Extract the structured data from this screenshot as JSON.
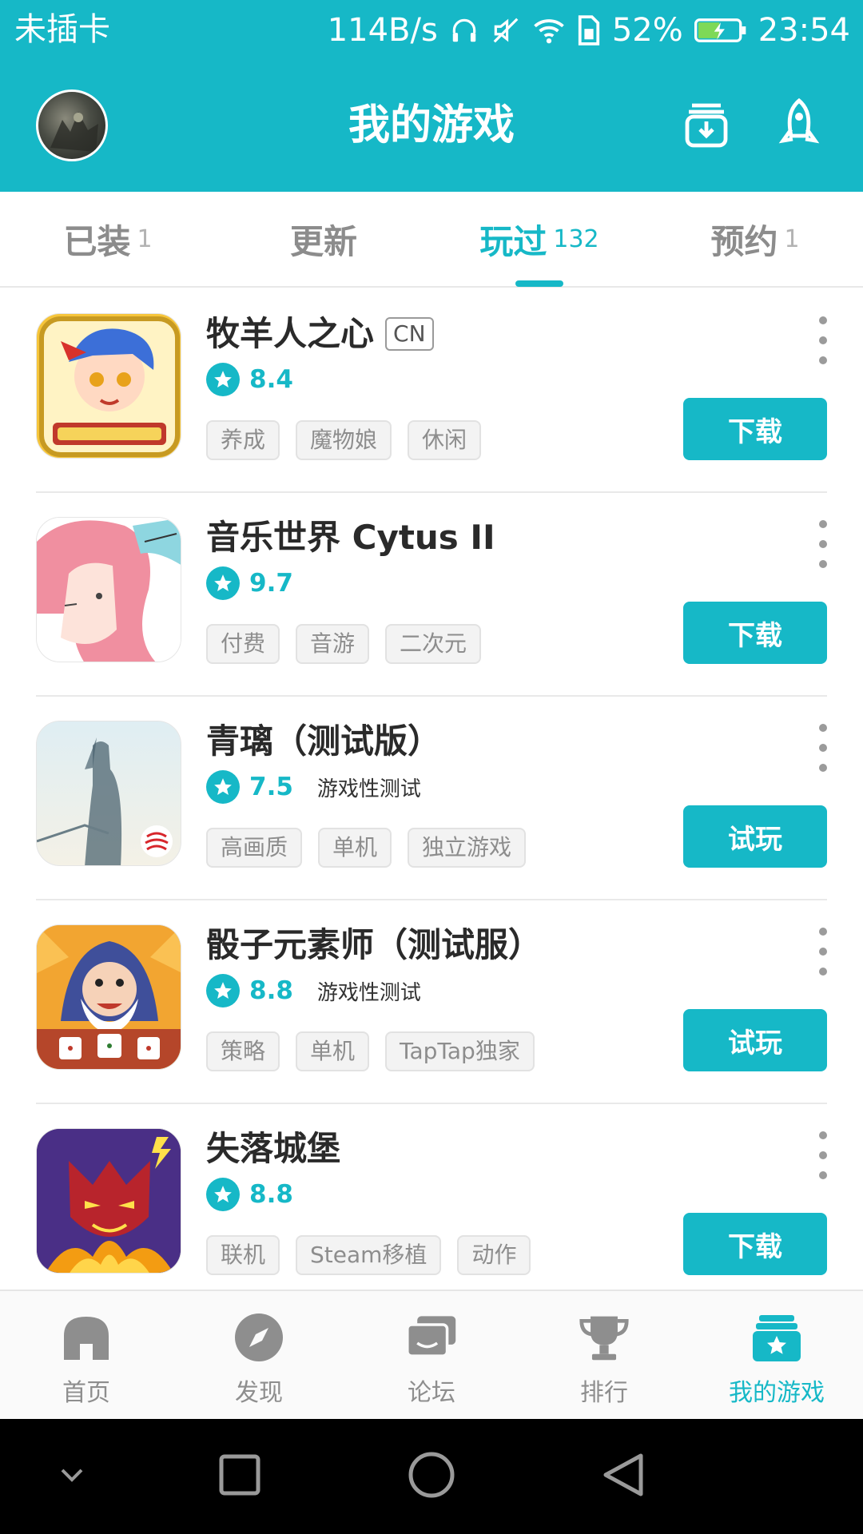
{
  "status_bar": {
    "carrier": "未插卡",
    "net_speed": "114B/s",
    "battery": "52%",
    "time": "23:54"
  },
  "header": {
    "title": "我的游戏",
    "avatar_icon": "user-avatar",
    "download_icon": "download-manager-icon",
    "rocket_icon": "rocket-icon"
  },
  "tabs": [
    {
      "label": "已装",
      "count": "1",
      "active": false
    },
    {
      "label": "更新",
      "count": "",
      "active": false
    },
    {
      "label": "玩过",
      "count": "132",
      "active": true
    },
    {
      "label": "预约",
      "count": "1",
      "active": false
    }
  ],
  "games": [
    {
      "title": "牧羊人之心",
      "badge": "CN",
      "score": "8.4",
      "note": "",
      "tags": [
        "养成",
        "魔物娘",
        "休闲"
      ],
      "action": "下载"
    },
    {
      "title": "音乐世界 Cytus II",
      "badge": "",
      "score": "9.7",
      "note": "",
      "tags": [
        "付费",
        "音游",
        "二次元"
      ],
      "action": "下载"
    },
    {
      "title": "青璃（测试版）",
      "badge": "",
      "score": "7.5",
      "note": "游戏性测试",
      "tags": [
        "高画质",
        "单机",
        "独立游戏"
      ],
      "action": "试玩"
    },
    {
      "title": "骰子元素师（测试服）",
      "badge": "",
      "score": "8.8",
      "note": "游戏性测试",
      "tags": [
        "策略",
        "单机",
        "TapTap独家"
      ],
      "action": "试玩"
    },
    {
      "title": "失落城堡",
      "badge": "",
      "score": "8.8",
      "note": "",
      "tags": [
        "联机",
        "Steam移植",
        "动作"
      ],
      "action": "下载"
    }
  ],
  "bottom_nav": [
    {
      "label": "首页",
      "icon": "home-icon",
      "active": false
    },
    {
      "label": "发现",
      "icon": "compass-icon",
      "active": false
    },
    {
      "label": "论坛",
      "icon": "forum-icon",
      "active": false
    },
    {
      "label": "排行",
      "icon": "trophy-icon",
      "active": false
    },
    {
      "label": "我的游戏",
      "icon": "my-games-icon",
      "active": true
    }
  ],
  "colors": {
    "accent": "#16b8c7",
    "inactive": "#8e8e8e"
  }
}
